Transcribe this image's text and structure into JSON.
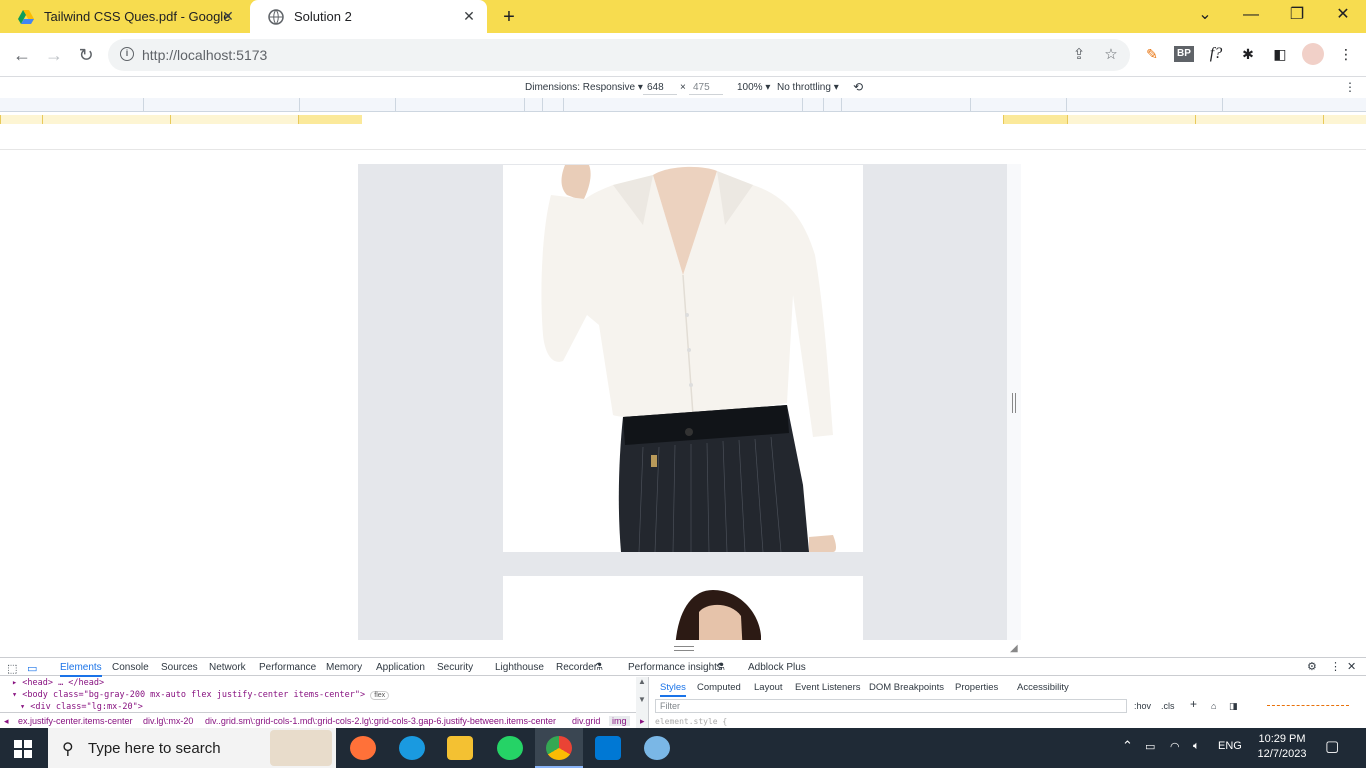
{
  "browser": {
    "tabs": [
      {
        "title": "Tailwind CSS Ques.pdf - Google",
        "favicon": "google-drive-icon",
        "active": false
      },
      {
        "title": "Solution 2",
        "favicon": "globe-icon",
        "active": true
      }
    ],
    "url": "http://localhost:5173",
    "accent": "#f7dc4f"
  },
  "device_toolbar": {
    "dimensions_label": "Dimensions: Responsive",
    "width": "648",
    "height": "475",
    "zoom": "100%",
    "throttling": "No throttling"
  },
  "devtools": {
    "tabs": [
      "Elements",
      "Console",
      "Sources",
      "Network",
      "Performance",
      "Memory",
      "Application",
      "Security",
      "Lighthouse",
      "Recorder",
      "Performance insights",
      "Adblock Plus"
    ],
    "code_lines": [
      "<head> … </head>",
      "<body class=\"bg-gray-200 mx-auto flex justify-center items-center\">",
      "<div class=\"lg:mx-20\">"
    ],
    "flex_badge": "flex",
    "breadcrumbs": [
      "ex.justify-center.items-center",
      "div.lg\\:mx-20",
      "div..grid.sm\\:grid-cols-1.md\\:grid-cols-2.lg\\:grid-cols-3.gap-6.justify-between.items-center",
      "div.grid",
      "img"
    ],
    "styles_tabs": [
      "Styles",
      "Computed",
      "Layout",
      "Event Listeners",
      "DOM Breakpoints",
      "Properties",
      "Accessibility"
    ],
    "filter_placeholder": "Filter",
    "hov": ":hov",
    "cls": ".cls",
    "element_style": "element.style {"
  },
  "taskbar": {
    "search_placeholder": "Type here to search",
    "language": "ENG",
    "time": "10:29 PM",
    "date": "12/7/2023"
  }
}
